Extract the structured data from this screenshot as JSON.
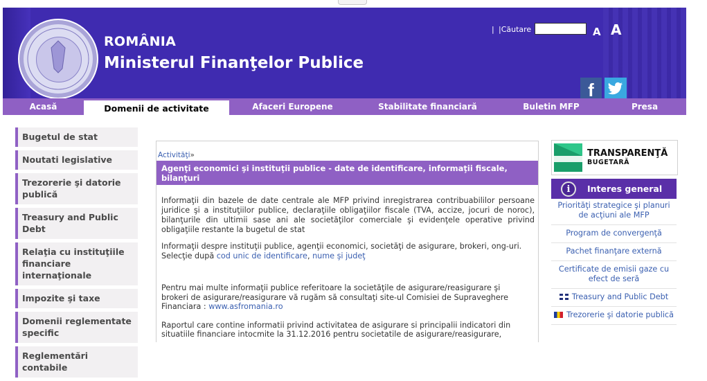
{
  "header": {
    "country": "ROMÂNIA",
    "ministry": "Ministerul Finanţelor Publice",
    "search_separator": "|",
    "search_label": "|Căutare",
    "search_value": "",
    "font_small": "A",
    "font_large": "A",
    "facebook_glyph": "f"
  },
  "nav": {
    "items": [
      {
        "label": "Acasă"
      },
      {
        "label": "Domenii de activitate"
      },
      {
        "label": "Afaceri Europene"
      },
      {
        "label": "Stabilitate financiară"
      },
      {
        "label": "Buletin MFP"
      },
      {
        "label": "Presa"
      }
    ]
  },
  "sidebar": {
    "items": [
      {
        "label": "Bugetul de stat"
      },
      {
        "label": "Noutati legislative"
      },
      {
        "label": "Trezorerie şi datorie publică"
      },
      {
        "label": "Treasury and Public Debt"
      },
      {
        "label": "Relaţia cu instituţiile financiare internaţionale"
      },
      {
        "label": "Impozite şi taxe"
      },
      {
        "label": "Domenii reglementate specific"
      },
      {
        "label": "Reglementări contabile"
      }
    ]
  },
  "main": {
    "breadcrumb": "Activităţi",
    "breadcrumb_arrow": "»",
    "title": "Agenţi economici şi instituţii publice - date de identificare, informaţii fiscale, bilanţuri",
    "paragraph1": "Informaţii din bazele de date centrale ale MFP privind inregistrarea contribuabililor persoane juridice şi a instituţiilor publice, declaraţiile obligaţiilor fiscale (TVA, accize, jocuri de noroc), bilanţurile din ultimii sase ani ale societăţilor comerciale şi evidenţele operative privind obligaţiile restante la bugetul de stat",
    "paragraph2_line1": "Informaţii despre instituţii publice, agenţii economici, societăţi de asigurare, brokeri, ong-uri.",
    "paragraph2_prefix": "Selecţie după ",
    "link_cod": "cod unic de identificare",
    "link_sep": ", ",
    "link_nume": "nume şi judeţ",
    "bullet1_text": "Pentru mai multe informaţii publice referitoare la societăţile de asigurare/reasigurare şi brokeri de asigurare/reasigurare vă rugăm să consultaţi site-ul Comisiei de Supraveghere Financiara : ",
    "bullet1_link": "www.asfromania.ro",
    "bullet2_text": "Raportul care contine informatii privind activitatea de asigurare si principalii indicatori din situatiile financiare intocmite la 31.12.2016 pentru societatile de asigurare/reasigurare,"
  },
  "right": {
    "transparency_title": "TRANSPARENŢĂ",
    "transparency_subtitle": "BUGETARĂ",
    "interest_icon": "i",
    "interest_title": "Interes general",
    "items": [
      {
        "label": "Priorităţi strategice şi planuri de acţiuni ale MFP"
      },
      {
        "label": "Program de convergenţă"
      },
      {
        "label": "Pachet finanţare externă"
      },
      {
        "label": "Certificate de emisii gaze cu efect de seră"
      },
      {
        "label": "Treasury and Public Debt"
      },
      {
        "label": "Trezorerie şi datorie publică"
      }
    ]
  }
}
